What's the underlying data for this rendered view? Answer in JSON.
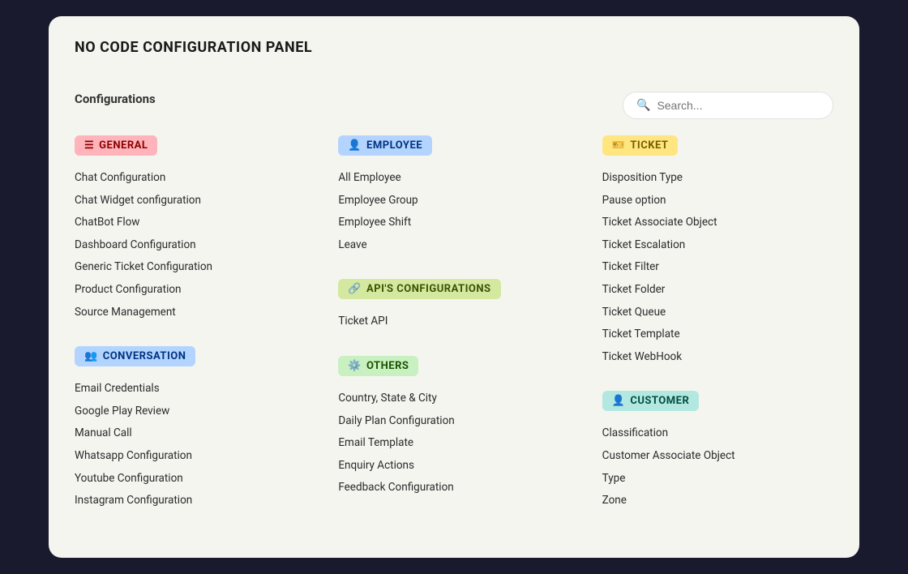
{
  "panel": {
    "title": "NO CODE CONFIGURATION PANEL",
    "configurations_label": "Configurations",
    "search_placeholder": "Search..."
  },
  "categories": [
    {
      "id": "general",
      "label": "GENERAL",
      "badge_class": "badge-pink",
      "icon": "⚙️",
      "column": 0,
      "items": [
        "Chat Configuration",
        "Chat Widget configuration",
        "ChatBot Flow",
        "Dashboard Configuration",
        "Generic Ticket Configuration",
        "Product Configuration",
        "Source Management"
      ]
    },
    {
      "id": "conversation",
      "label": "CONVERSATION",
      "badge_class": "badge-blue",
      "icon": "👥",
      "column": 0,
      "items": [
        "Email Credentials",
        "Google Play Review",
        "Manual Call",
        "Whatsapp Configuration",
        "Youtube Configuration",
        "Instagram Configuration"
      ]
    },
    {
      "id": "employee",
      "label": "EMPLOYEE",
      "badge_class": "badge-blue",
      "icon": "👤",
      "column": 1,
      "items": [
        "All Employee",
        "Employee Group",
        "Employee Shift",
        "Leave"
      ]
    },
    {
      "id": "apis",
      "label": "API'S CONFIGURATIONS",
      "badge_class": "badge-yellow-green",
      "icon": "🔗",
      "column": 1,
      "items": [
        "Ticket API"
      ]
    },
    {
      "id": "others",
      "label": "OTHERS",
      "badge_class": "badge-green",
      "icon": "⚙️",
      "column": 1,
      "items": [
        "Country, State & City",
        "Daily Plan Configuration",
        "Email Template",
        "Enquiry Actions",
        "Feedback Configuration"
      ]
    },
    {
      "id": "ticket",
      "label": "TICKET",
      "badge_class": "badge-yellow",
      "icon": "🎫",
      "column": 2,
      "items": [
        "Disposition Type",
        "Pause option",
        "Ticket Associate Object",
        "Ticket Escalation",
        "Ticket Filter",
        "Ticket Folder",
        "Ticket Queue",
        "Ticket Template",
        "Ticket WebHook"
      ]
    },
    {
      "id": "customer",
      "label": "CUSTOMER",
      "badge_class": "badge-teal",
      "icon": "👤",
      "column": 2,
      "items": [
        "Classification",
        "Customer Associate Object",
        "Type",
        "Zone"
      ]
    }
  ]
}
